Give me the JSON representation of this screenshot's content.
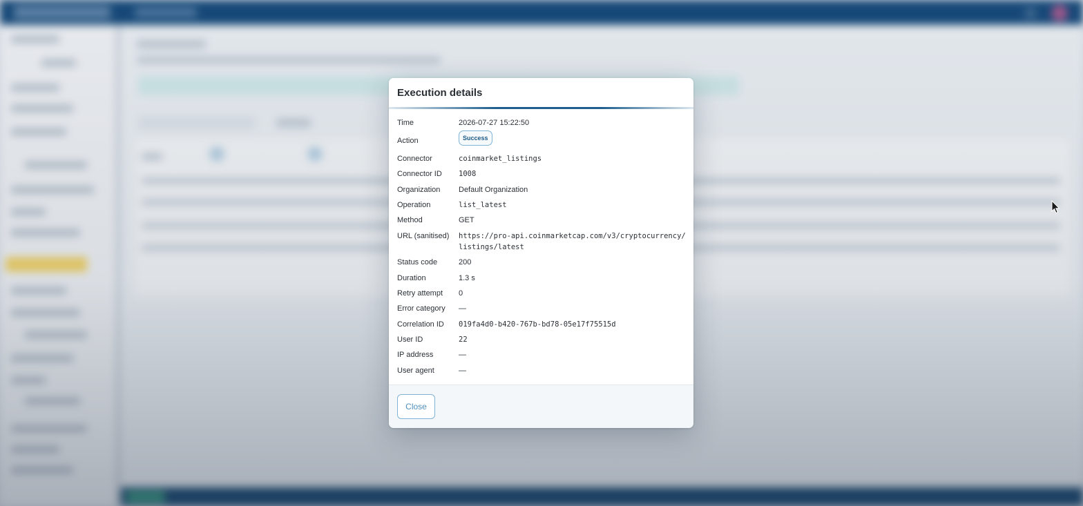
{
  "modal": {
    "title": "Execution details",
    "fields": {
      "time": {
        "label": "Time",
        "value": "2026-07-27 15:22:50"
      },
      "action": {
        "label": "Action",
        "value": "Success"
      },
      "connector": {
        "label": "Connector",
        "value": "coinmarket_listings"
      },
      "connector_id": {
        "label": "Connector ID",
        "value": "1008"
      },
      "organization": {
        "label": "Organization",
        "value": "Default Organization"
      },
      "operation": {
        "label": "Operation",
        "value": "list_latest"
      },
      "method": {
        "label": "Method",
        "value": "GET"
      },
      "url": {
        "label": "URL (sanitised)",
        "value_line1": "https://pro-api.coinmarketcap.com/v3/cryptocurrency/",
        "value_line2": "listings/latest"
      },
      "status_code": {
        "label": "Status code",
        "value": "200"
      },
      "duration": {
        "label": "Duration",
        "value": "1.3 s"
      },
      "retry_attempt": {
        "label": "Retry attempt",
        "value": "0"
      },
      "error_category": {
        "label": "Error category",
        "value": "—"
      },
      "correlation_id": {
        "label": "Correlation ID",
        "value": "019fa4d0-b420-767b-bd78-05e17f75515d"
      },
      "user_id": {
        "label": "User ID",
        "value": "22"
      },
      "ip_address": {
        "label": "IP address",
        "value": "—"
      },
      "user_agent": {
        "label": "User agent",
        "value": "—"
      }
    },
    "close_label": "Close"
  },
  "colors": {
    "topbar": "#15497a",
    "accent": "#1f5f8f",
    "badge_border": "#7fb3d6",
    "badge_text": "#1d5a86",
    "close_text": "#4e8fbd"
  },
  "icons": {
    "cursor": "mouse-pointer-icon"
  }
}
